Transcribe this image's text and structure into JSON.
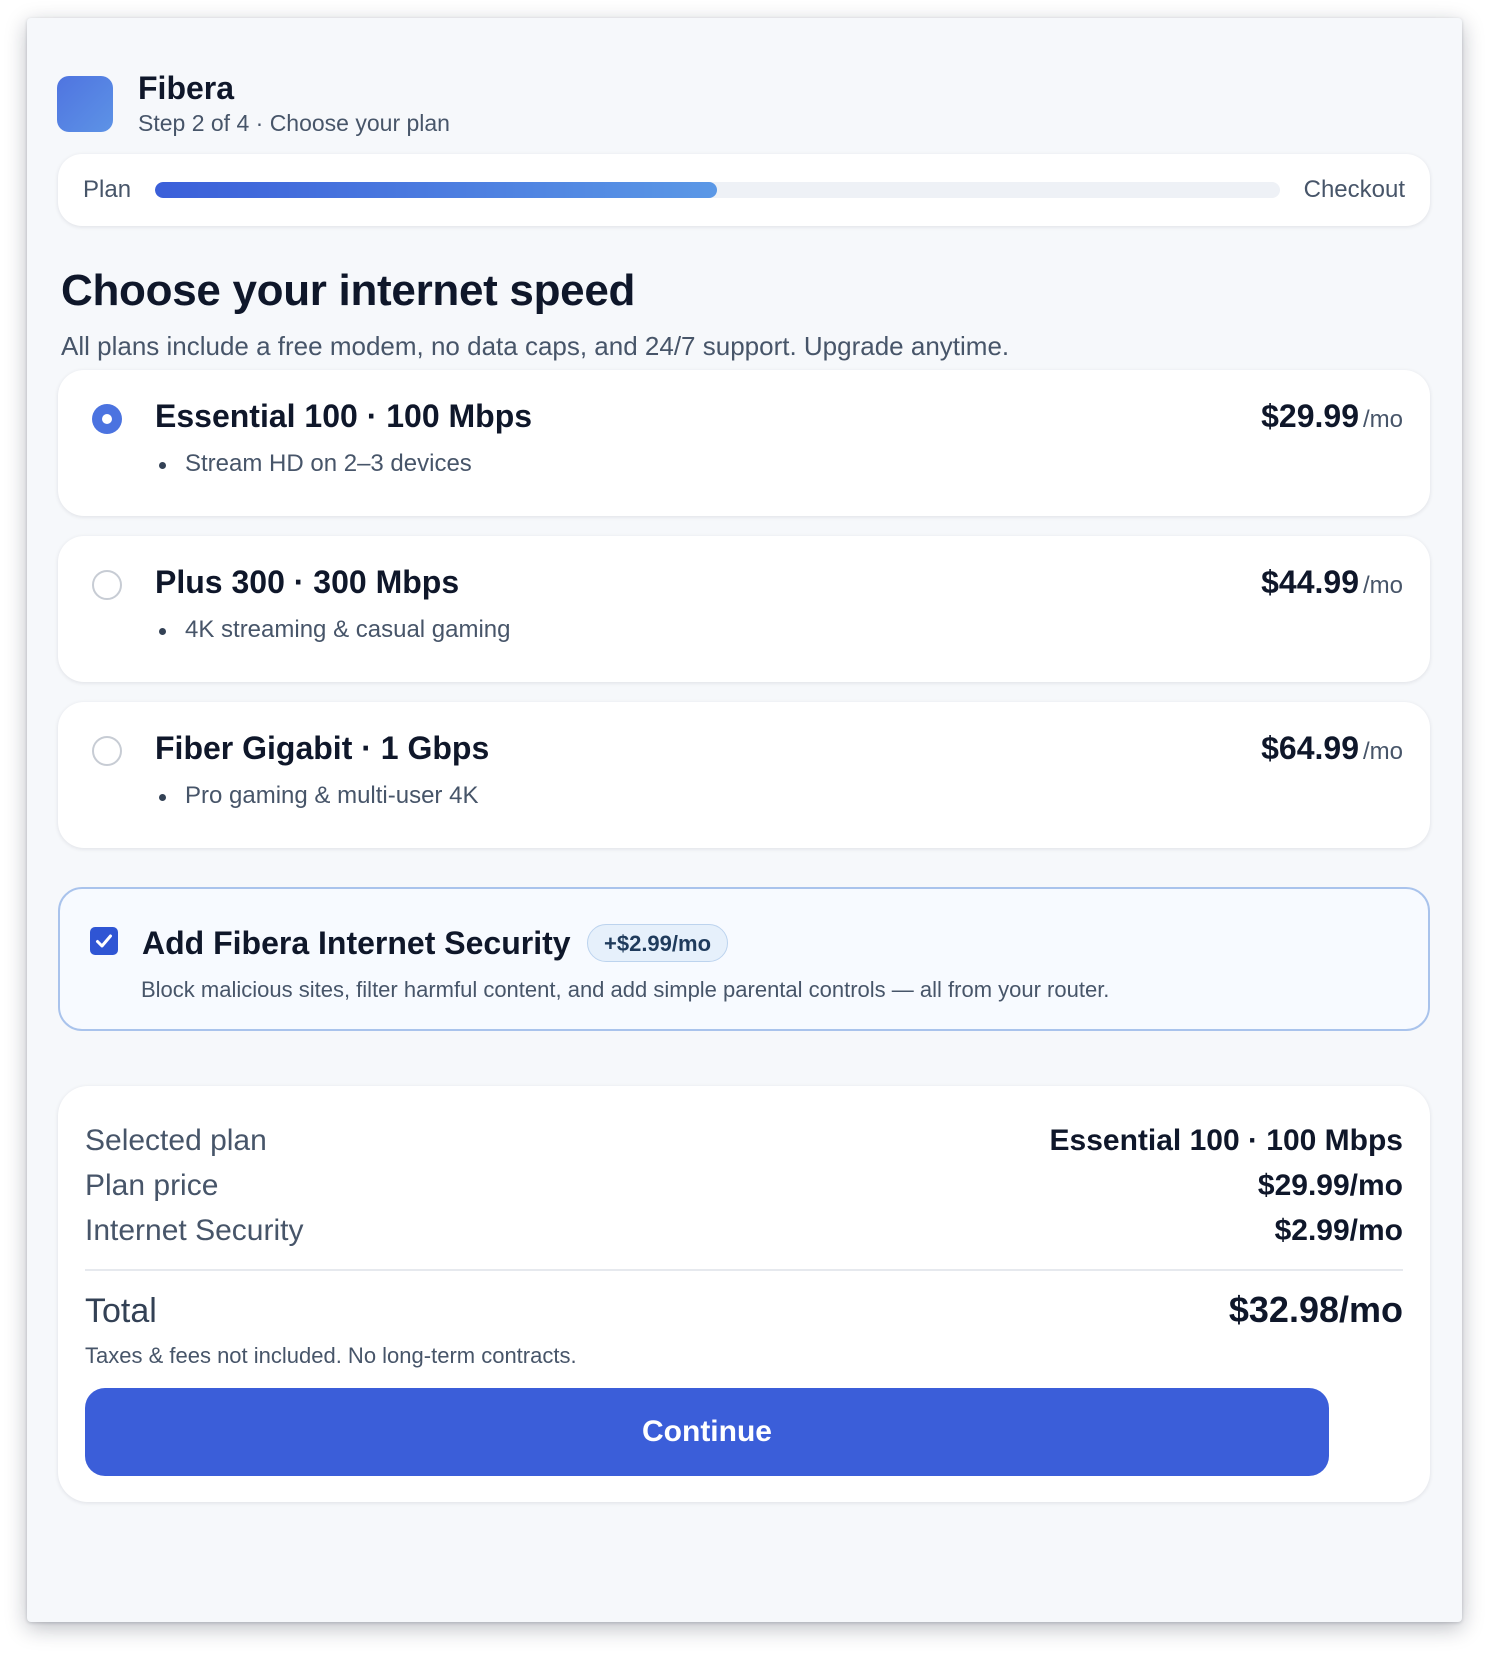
{
  "brand": {
    "name": "Fibera",
    "step": "Step 2 of 4 · Choose your plan"
  },
  "progress": {
    "start_label": "Plan",
    "end_label": "Checkout",
    "fraction": 0.5,
    "accent_start": "#3b5fd9",
    "accent_end": "#5b98e6"
  },
  "page": {
    "title": "Choose your internet speed",
    "subtitle": "All plans include a free modem, no data caps, and 24/7 support. Upgrade anytime."
  },
  "plans": [
    {
      "name": "Essential 100 · 100 Mbps",
      "feature": "Stream HD on 2–3 devices",
      "price": "$29.99",
      "per": "/mo",
      "selected": true
    },
    {
      "name": "Plus 300 · 300 Mbps",
      "feature": "4K streaming & casual gaming",
      "price": "$44.99",
      "per": "/mo",
      "selected": false
    },
    {
      "name": "Fiber Gigabit · 1 Gbps",
      "feature": "Pro gaming & multi-user 4K",
      "price": "$64.99",
      "per": "/mo",
      "selected": false
    }
  ],
  "addon": {
    "checked": true,
    "title": "Add Fibera Internet Security",
    "badge": "+$2.99/mo",
    "description": "Block malicious sites, filter harmful content, and add simple parental controls — all from your router."
  },
  "summary": {
    "selected_plan_label": "Selected plan",
    "selected_plan_value": "Essential 100 · 100 Mbps",
    "plan_price_label": "Plan price",
    "plan_price_value": "$29.99/mo",
    "security_label": "Internet Security",
    "security_value": "$2.99/mo",
    "total_label": "Total",
    "total_value": "$32.98/mo",
    "note": "Taxes & fees not included. No long-term contracts."
  },
  "continue_label": "Continue",
  "colors": {
    "primary": "#3b5ed9",
    "checkbox": "#2f55d4",
    "radio_selected": "#4b73e0"
  }
}
